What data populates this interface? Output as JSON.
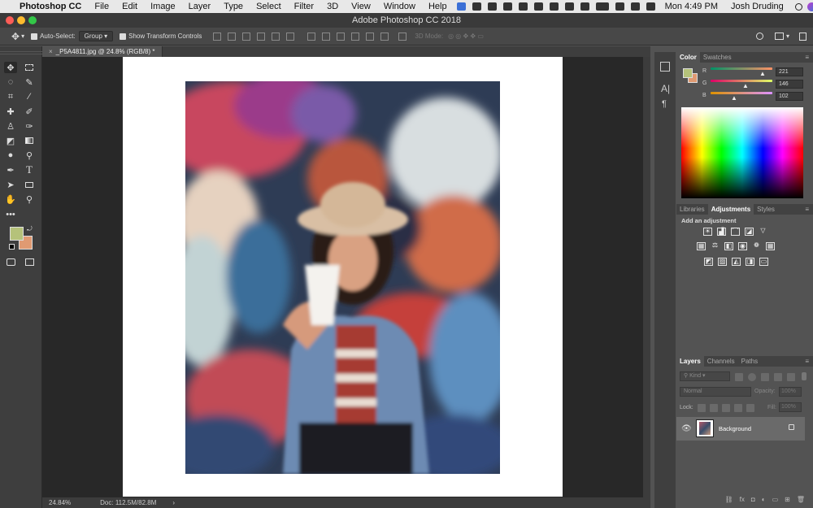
{
  "menubar": {
    "app": "Photoshop CC",
    "items": [
      "File",
      "Edit",
      "Image",
      "Layer",
      "Type",
      "Select",
      "Filter",
      "3D",
      "View",
      "Window",
      "Help"
    ],
    "clock": "Mon 4:49 PM",
    "user": "Josh Druding"
  },
  "window": {
    "title": "Adobe Photoshop CC 2018"
  },
  "options": {
    "auto_select_label": "Auto-Select:",
    "auto_select_value": "Group",
    "transform_label": "Show Transform Controls",
    "mode_3d_label": "3D Mode:"
  },
  "document": {
    "tab_title": "_P5A4811.jpg @ 24.8% (RGB/8) *"
  },
  "status": {
    "zoom": "24.84%",
    "doc": "Doc: 112.5M/82.8M"
  },
  "colors": {
    "foreground": "#b5c27a",
    "background": "#e09a72"
  },
  "color_panel": {
    "tabs": [
      "Color",
      "Swatches"
    ],
    "r": {
      "label": "R",
      "value": "221"
    },
    "g": {
      "label": "G",
      "value": "146"
    },
    "b": {
      "label": "B",
      "value": "102"
    }
  },
  "adjustments_panel": {
    "tabs": [
      "Libraries",
      "Adjustments",
      "Styles"
    ],
    "hint": "Add an adjustment"
  },
  "layers_panel": {
    "tabs": [
      "Layers",
      "Channels",
      "Paths"
    ],
    "kind": "Kind",
    "blend": "Normal",
    "opacity_label": "Opacity:",
    "opacity_value": "100%",
    "lock_label": "Lock:",
    "fill_label": "Fill:",
    "fill_value": "100%",
    "layer_name": "Background"
  }
}
